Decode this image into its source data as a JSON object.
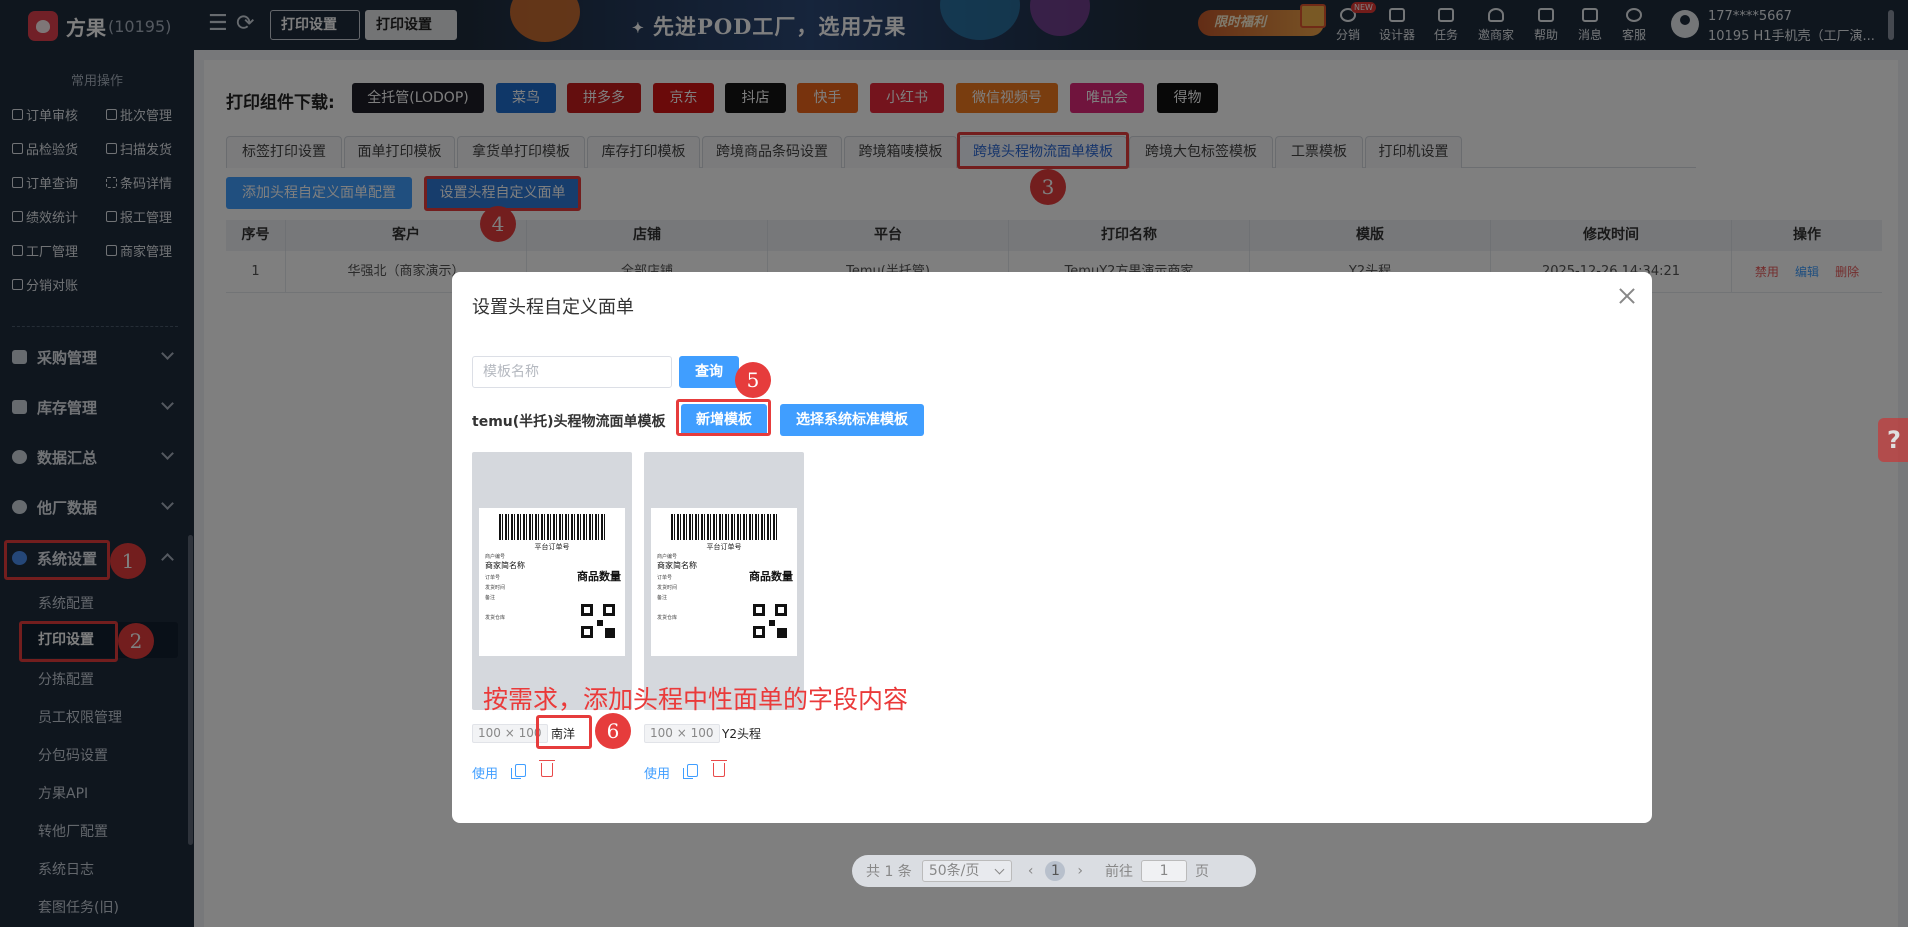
{
  "topbar": {
    "brand_name": "方果",
    "brand_id": "(10195)",
    "tabs": [
      "打印设置",
      "打印设置"
    ],
    "banner_text": "先进POD工厂，选用方果",
    "promo_text": "限时福利",
    "tools": [
      {
        "label": "分销",
        "icon": "share-icon",
        "badge": "NEW"
      },
      {
        "label": "设计器",
        "icon": "image-icon"
      },
      {
        "label": "任务",
        "icon": "task-icon"
      },
      {
        "label": "邀商家",
        "icon": "users-icon"
      },
      {
        "label": "帮助",
        "icon": "help-icon"
      },
      {
        "label": "消息",
        "icon": "message-icon"
      },
      {
        "label": "客服",
        "icon": "headset-icon"
      }
    ],
    "user_phone": "177****5667",
    "user_company": "10195 H1手机壳（工厂演..."
  },
  "sidebar": {
    "section_label": "常用操作",
    "quick_ops": [
      "订单审核",
      "批次管理",
      "品检验货",
      "扫描发货",
      "订单查询",
      "条码详情",
      "绩效统计",
      "报工管理",
      "工厂管理",
      "商家管理",
      "分销对账"
    ],
    "menus": [
      "采购管理",
      "库存管理",
      "数据汇总",
      "他厂数据",
      "系统设置"
    ],
    "sub_items": [
      "系统配置",
      "打印设置",
      "分拣配置",
      "员工权限管理",
      "分包码设置",
      "方果API",
      "转他厂配置",
      "系统日志",
      "套图任务(旧)"
    ]
  },
  "downloads": {
    "title": "打印组件下载:",
    "chips": [
      {
        "label": "全托管(LODOP)",
        "color": "#1e1e28"
      },
      {
        "label": "菜鸟",
        "color": "#1f6fd1"
      },
      {
        "label": "拼多多",
        "color": "#c91d1d"
      },
      {
        "label": "京东",
        "color": "#d51414"
      },
      {
        "label": "抖店",
        "color": "#151515"
      },
      {
        "label": "快手",
        "color": "#f0661a"
      },
      {
        "label": "小红书",
        "color": "#e8283a"
      },
      {
        "label": "微信视频号",
        "color": "#f27b1f"
      },
      {
        "label": "唯品会",
        "color": "#e0287a"
      },
      {
        "label": "得物",
        "color": "#111111"
      }
    ]
  },
  "tabs": [
    "标签打印设置",
    "面单打印模板",
    "拿货单打印模板",
    "库存打印模板",
    "跨境商品条码设置",
    "跨境箱唛模板",
    "跨境头程物流面单模板",
    "跨境大包标签模板",
    "工票模板",
    "打印机设置"
  ],
  "actions": {
    "add_config": "添加头程自定义面单配置",
    "set_custom": "设置头程自定义面单"
  },
  "table": {
    "headers": [
      "序号",
      "客户",
      "店铺",
      "平台",
      "打印名称",
      "模版",
      "修改时间",
      "操作"
    ],
    "rows": [
      {
        "index": "1",
        "customer": "华强北（商家演示）",
        "shop": "全部店铺",
        "platform": "Temu(半托管)",
        "print_name": "TemuY2方果演示商家",
        "template": "Y2头程",
        "modified": "2025-12-26 14:34:21",
        "ops": [
          "禁用",
          "编辑",
          "删除"
        ]
      }
    ]
  },
  "pagination": {
    "total": "共 1 条",
    "page_size": "50条/页",
    "current": "1",
    "goto_label": "前往",
    "goto_value": "1",
    "page_suffix": "页"
  },
  "help_tab": "?",
  "modal": {
    "title": "设置头程自定义面单",
    "search_placeholder": "模板名称",
    "search_btn": "查询",
    "section_label": "temu(半托)头程物流面单模板",
    "add_btn": "新增模板",
    "sys_btn": "选择系统标准模板",
    "preview": {
      "order_no": "平台订单号",
      "small_a": "商户编号",
      "shop_name": "商家简名称",
      "qty": "商品数量",
      "small_b": "订单号",
      "small_c": "发货时间",
      "small_d": "备注",
      "small_e": "发货仓库"
    },
    "cards": [
      {
        "size": "100 × 100",
        "name": "南洋",
        "use": "使用"
      },
      {
        "size": "100 × 100",
        "name": "Y2头程",
        "use": "使用"
      }
    ]
  },
  "annotations": {
    "note": "按需求，添加头程中性面单的字段内容",
    "numbers": [
      "1",
      "2",
      "3",
      "4",
      "5",
      "6"
    ]
  }
}
